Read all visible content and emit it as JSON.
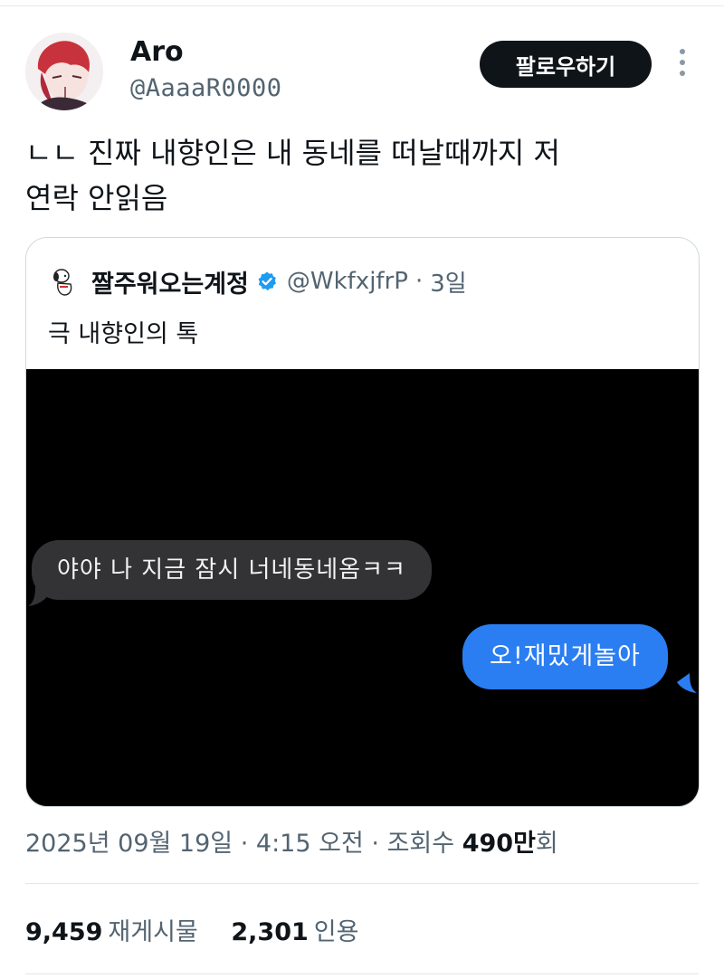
{
  "author": {
    "name": "Aro",
    "handle": "@AaaaR0000",
    "follow_label": "팔로우하기"
  },
  "tweet": {
    "text_line1": "ㄴㄴ 진짜 내향인은 내 동네를 떠날때까지 저",
    "text_line2": "연락 안읽음"
  },
  "quote": {
    "name": "짤주워오는계정",
    "handle": "@WkfxjfrP",
    "separator": "·",
    "time": "3일",
    "text": "극 내향인의 톡",
    "chat": {
      "incoming": "야야 나 지금 잠시 너네동네옴ㅋㅋ",
      "outgoing": "오!재밌게놀아"
    }
  },
  "meta": {
    "date": "2025년 09월 19일",
    "sep1": "·",
    "time": "4:15 오전",
    "sep2": "·",
    "views_label": "조회수",
    "views_value": "490만",
    "views_suffix": "회"
  },
  "stats": {
    "reposts_count": "9,459",
    "reposts_label": "재게시물",
    "quotes_count": "2,301",
    "quotes_label": "인용"
  },
  "colors": {
    "follow_bg": "#0f1419",
    "verified": "#1d9bf0",
    "outgoing_bubble": "#2b7ef2",
    "incoming_bubble": "#333335",
    "secondary_text": "#536471"
  },
  "icons": [
    "more-vertical-icon",
    "verified-badge-icon"
  ]
}
